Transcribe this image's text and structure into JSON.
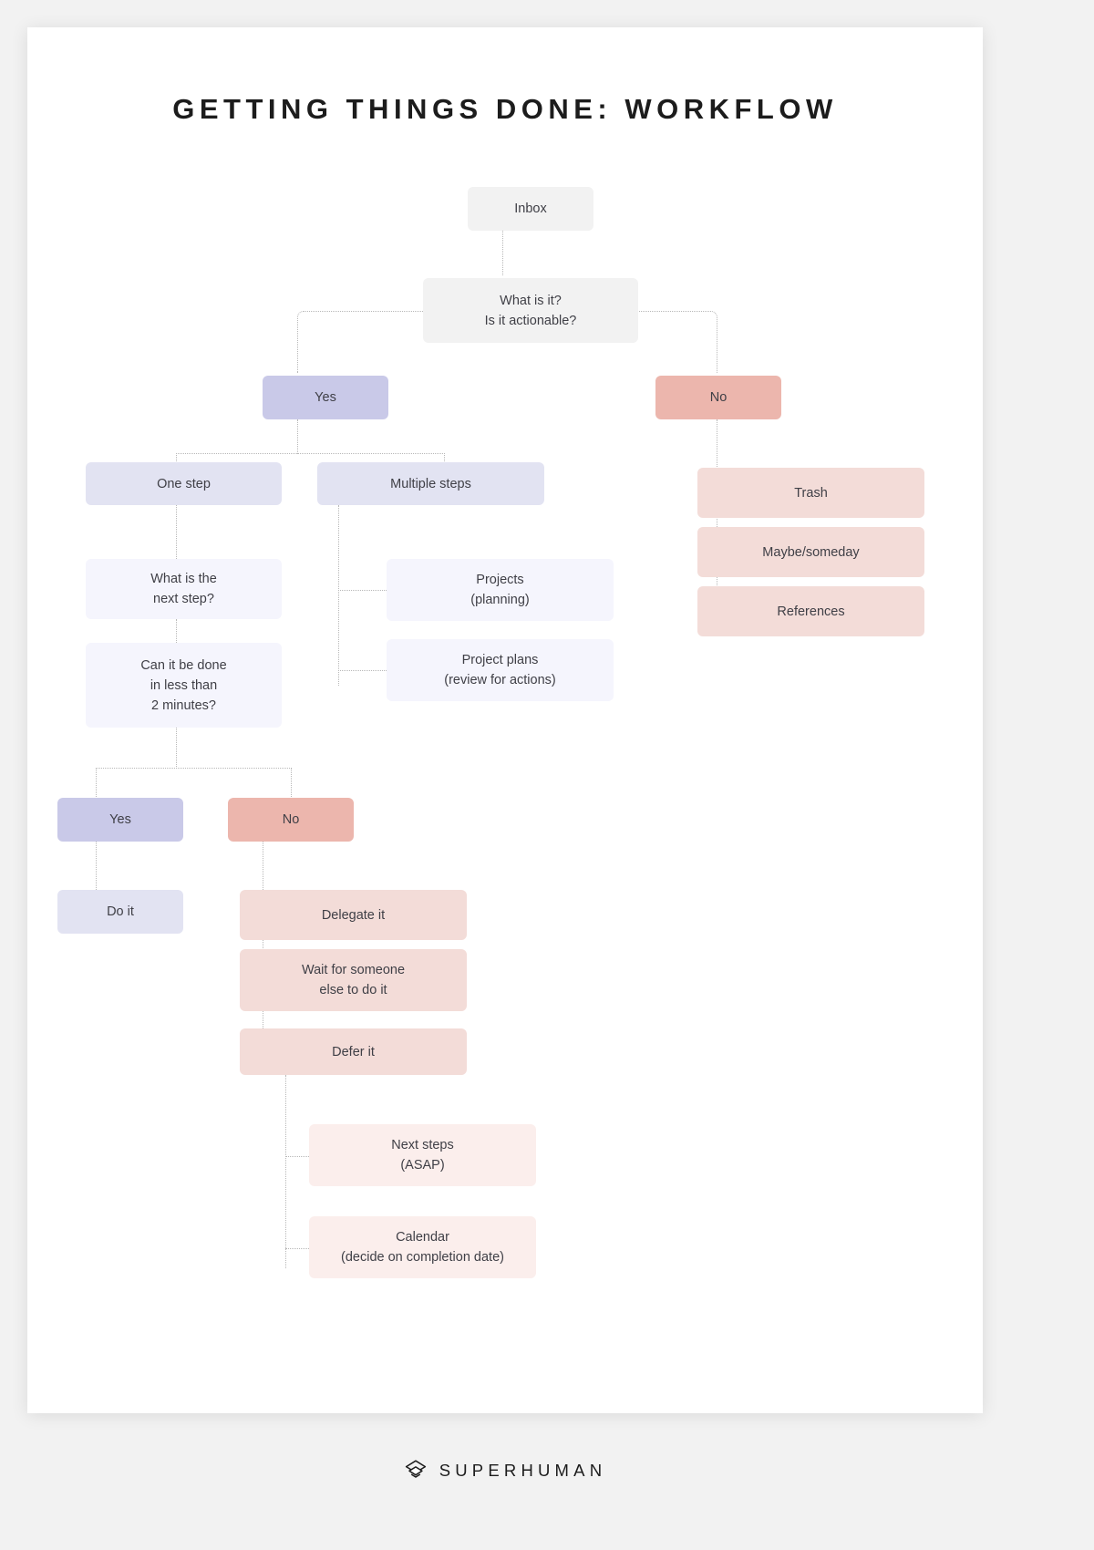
{
  "page": {
    "title": "GETTING THINGS DONE: WORKFLOW",
    "background_color": "#f2f2f2",
    "card_color": "#ffffff"
  },
  "palette": {
    "neutral": "#f2f2f2",
    "lavender": "#c9c9e8",
    "lavender_mid": "#e2e3f2",
    "lavender_pale": "#f5f5fd",
    "salmon": "#ecb6ad",
    "rose_mid": "#f3dcd8",
    "rose_pale": "#fbeeec",
    "text": "#3f3f46",
    "connector": "#b8b8b8"
  },
  "footer": {
    "brand": "SUPERHUMAN",
    "mark": "stacked-diamonds-icon"
  },
  "chart_data": {
    "type": "diagram",
    "subtype": "flowchart",
    "title": "GETTING THINGS DONE: WORKFLOW",
    "nodes": [
      {
        "id": "inbox",
        "label": "Inbox",
        "tone": "neutral"
      },
      {
        "id": "what-is-it",
        "label": "What is it?\nIs it actionable?",
        "tone": "neutral"
      },
      {
        "id": "yes-1",
        "label": "Yes",
        "tone": "lavender"
      },
      {
        "id": "no-1",
        "label": "No",
        "tone": "salmon"
      },
      {
        "id": "one-step",
        "label": "One step",
        "tone": "lavender_mid"
      },
      {
        "id": "multiple-steps",
        "label": "Multiple steps",
        "tone": "lavender_mid"
      },
      {
        "id": "trash",
        "label": "Trash",
        "tone": "rose_mid"
      },
      {
        "id": "maybe-someday",
        "label": "Maybe/someday",
        "tone": "rose_mid"
      },
      {
        "id": "references",
        "label": "References",
        "tone": "rose_mid"
      },
      {
        "id": "next-step-q",
        "label": "What is the\nnext step?",
        "tone": "lavender_pale"
      },
      {
        "id": "two-minutes-q",
        "label": "Can it be done\nin less than\n2 minutes?",
        "tone": "lavender_pale"
      },
      {
        "id": "projects",
        "label": "Projects\n(planning)",
        "tone": "lavender_pale"
      },
      {
        "id": "project-plans",
        "label": "Project plans\n(review for actions)",
        "tone": "lavender_pale"
      },
      {
        "id": "yes-2",
        "label": "Yes",
        "tone": "lavender"
      },
      {
        "id": "no-2",
        "label": "No",
        "tone": "salmon"
      },
      {
        "id": "do-it",
        "label": "Do it",
        "tone": "lavender_mid"
      },
      {
        "id": "delegate-it",
        "label": "Delegate it",
        "tone": "rose_mid"
      },
      {
        "id": "wait-for",
        "label": "Wait for someone\nelse to do it",
        "tone": "rose_mid"
      },
      {
        "id": "defer-it",
        "label": "Defer it",
        "tone": "rose_mid"
      },
      {
        "id": "next-steps",
        "label": "Next steps\n(ASAP)",
        "tone": "rose_pale"
      },
      {
        "id": "calendar",
        "label": "Calendar\n(decide on completion date)",
        "tone": "rose_pale"
      }
    ],
    "edges": [
      {
        "from": "inbox",
        "to": "what-is-it"
      },
      {
        "from": "what-is-it",
        "to": "yes-1"
      },
      {
        "from": "what-is-it",
        "to": "no-1"
      },
      {
        "from": "yes-1",
        "to": "one-step"
      },
      {
        "from": "yes-1",
        "to": "multiple-steps"
      },
      {
        "from": "no-1",
        "to": "trash"
      },
      {
        "from": "no-1",
        "to": "maybe-someday"
      },
      {
        "from": "no-1",
        "to": "references"
      },
      {
        "from": "one-step",
        "to": "next-step-q"
      },
      {
        "from": "next-step-q",
        "to": "two-minutes-q"
      },
      {
        "from": "multiple-steps",
        "to": "projects"
      },
      {
        "from": "multiple-steps",
        "to": "project-plans"
      },
      {
        "from": "two-minutes-q",
        "to": "yes-2"
      },
      {
        "from": "two-minutes-q",
        "to": "no-2"
      },
      {
        "from": "yes-2",
        "to": "do-it"
      },
      {
        "from": "no-2",
        "to": "delegate-it"
      },
      {
        "from": "no-2",
        "to": "wait-for"
      },
      {
        "from": "no-2",
        "to": "defer-it"
      },
      {
        "from": "defer-it",
        "to": "next-steps"
      },
      {
        "from": "defer-it",
        "to": "calendar"
      }
    ]
  }
}
